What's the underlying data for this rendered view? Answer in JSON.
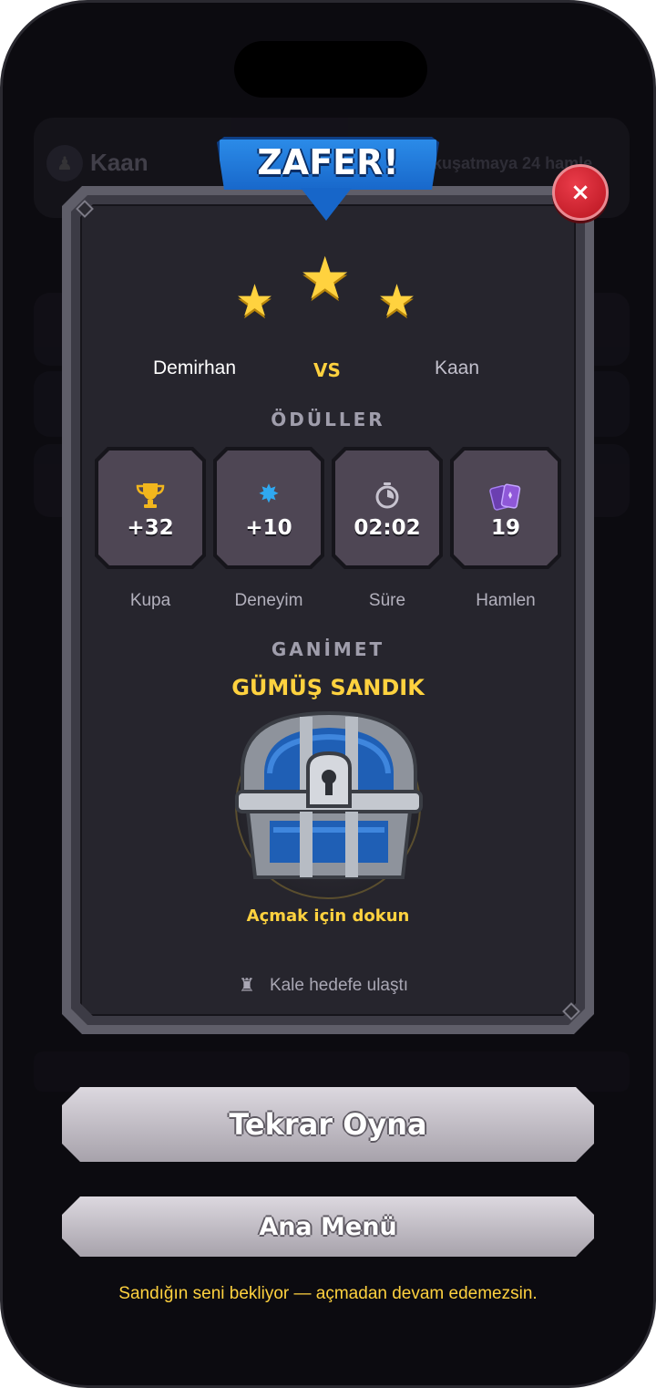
{
  "background": {
    "opponent_name": "Kaan",
    "turns_text": "kuşatmaya 24 hamle"
  },
  "banner": {
    "title": "ZAFER!"
  },
  "close_label": "×",
  "stars": {
    "earned": 3,
    "total": 3
  },
  "match": {
    "player": "Demirhan",
    "vs": "VS",
    "opponent": "Kaan"
  },
  "rewards": {
    "title": "ÖDÜLLER",
    "items": [
      {
        "icon": "trophy-icon",
        "value": "+32",
        "label": "Kupa",
        "color": "#f2b61d"
      },
      {
        "icon": "xp-star-icon",
        "value": "+10",
        "label": "Deneyim",
        "color": "#2fa8f0"
      },
      {
        "icon": "stopwatch-icon",
        "value": "02:02",
        "label": "Süre",
        "color": "#c7c3cf"
      },
      {
        "icon": "cards-icon",
        "value": "19",
        "label": "Hamlen",
        "color": "#8f58d8"
      }
    ]
  },
  "loot": {
    "title": "GANİMET",
    "chest_name": "GÜMÜŞ SANDIK",
    "chest_icon": "silver-chest-icon",
    "hint": "Açmak için dokun"
  },
  "castle_note": "Kale hedefe ulaştı",
  "buttons": {
    "play_again": "Tekrar Oyna",
    "main_menu": "Ana Menü"
  },
  "footer_note": "Sandığın seni bekliyor — açmadan devam edemezsin.",
  "colors": {
    "accent_gold": "#ffd23f",
    "banner_blue": "#1f78de",
    "close_red": "#d4202d",
    "panel_dark": "#26252d"
  }
}
